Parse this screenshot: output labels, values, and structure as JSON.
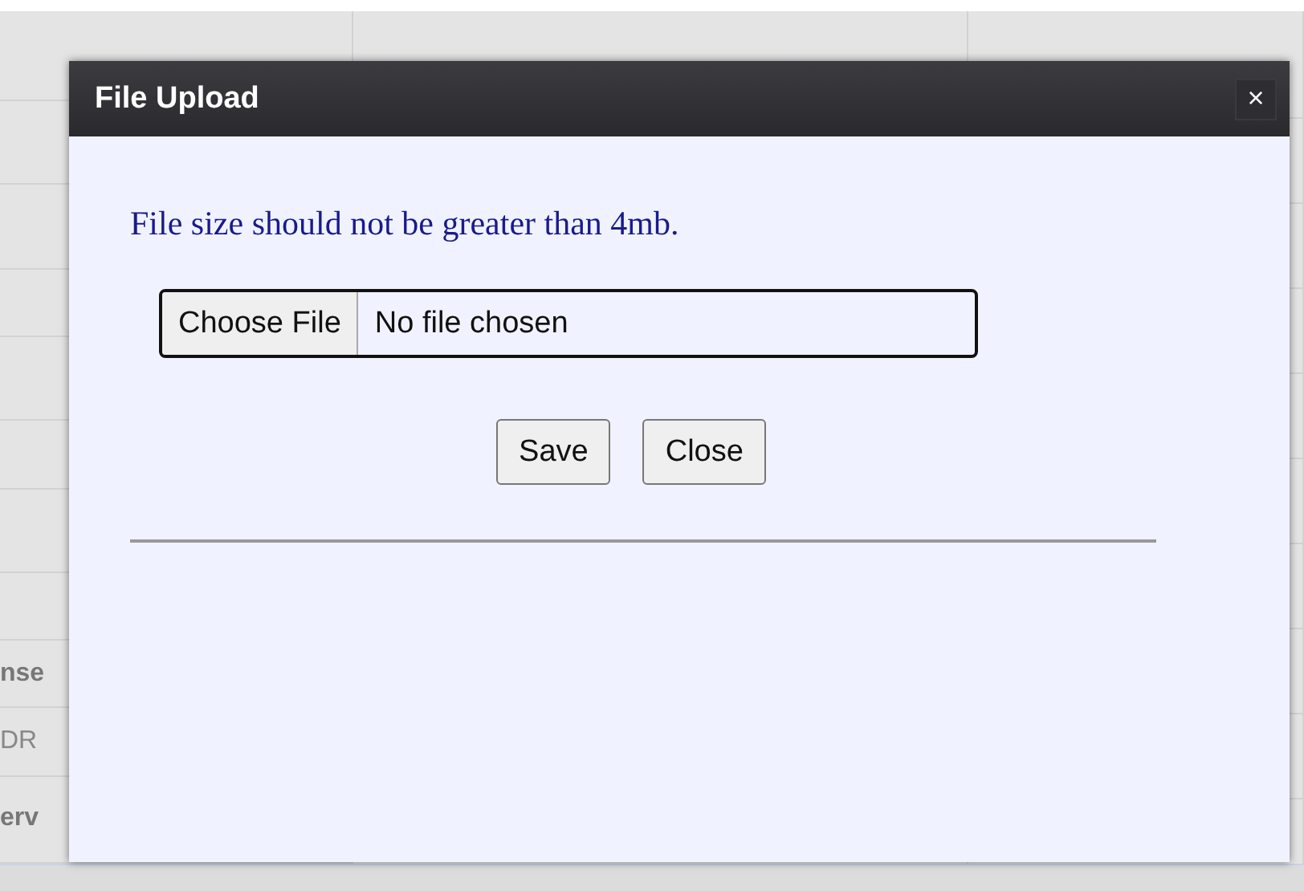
{
  "background": {
    "left_fragments": [
      {
        "text": "nse",
        "bold": true
      },
      {
        "text": "DR",
        "bold": false
      },
      {
        "text": "erv",
        "bold": true
      }
    ]
  },
  "dialog": {
    "title": "File Upload",
    "close_glyph": "×",
    "message": "File size should not be greater than 4mb.",
    "file_input": {
      "button": "Choose File",
      "status": "No file chosen"
    },
    "buttons": [
      "Save",
      "Close"
    ]
  }
}
